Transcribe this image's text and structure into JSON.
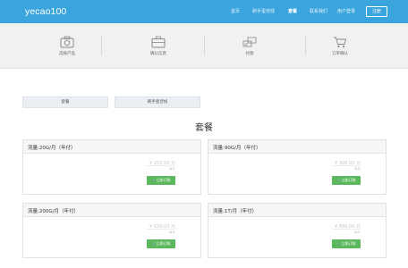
{
  "header": {
    "logo": "yecao100",
    "nav": [
      "首页",
      "刷手蛋佳栈",
      "套餐",
      "联系我们",
      "用户登录"
    ],
    "active_nav": "套餐",
    "register_label": "注册"
  },
  "steps": [
    {
      "label": "选择产品",
      "icon": "camera-icon"
    },
    {
      "label": "确认信息",
      "icon": "briefcase-icon"
    },
    {
      "label": "付款",
      "icon": "payment-icon"
    },
    {
      "label": "订单确认",
      "icon": "cart-icon"
    }
  ],
  "tabs": [
    "套餐",
    "刷手蛋佳栈"
  ],
  "section_title": "套餐",
  "plans": [
    {
      "title": "流量:20G/月（年付）",
      "price": "¥ 252.00 元",
      "unit": "每年",
      "button": "立即订购"
    },
    {
      "title": "流量:90G/月（年付）",
      "price": "¥ 306.00 元",
      "unit": "每年",
      "button": "立即订购"
    },
    {
      "title": "流量:200G/月（年付）",
      "price": "¥ 620.00 元",
      "unit": "每年",
      "button": "立即订购"
    },
    {
      "title": "流量:1T/月（年付）",
      "price": "¥ 880.00 元",
      "unit": "每年",
      "button": "立即订购"
    }
  ],
  "colors": {
    "header_bg": "#3aa4dd",
    "buy_button": "#5cb85c"
  }
}
